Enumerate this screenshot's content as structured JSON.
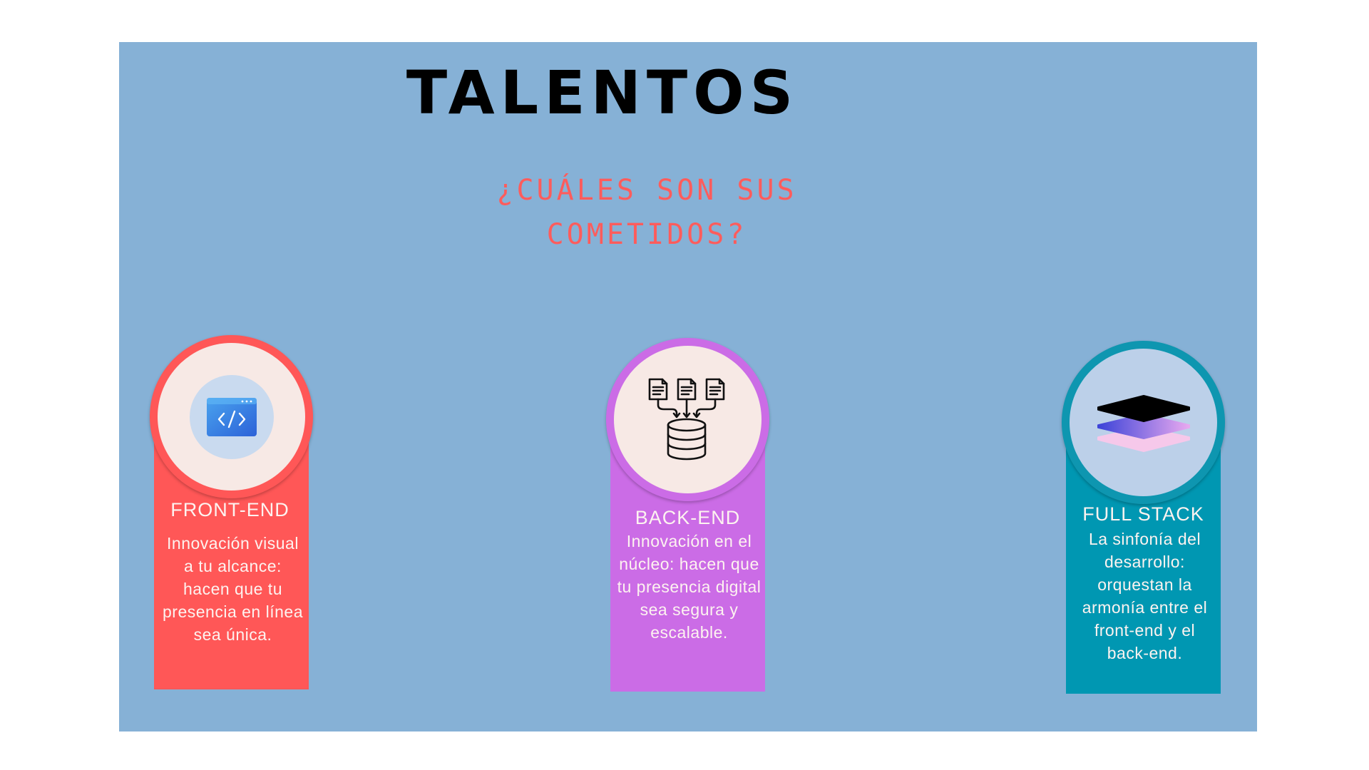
{
  "slide": {
    "title": "TALENTOS",
    "subtitle": "¿Cuáles son sus cometidos?",
    "background": "#86b1d6",
    "title_color": "#000000",
    "subtitle_color": "#ff5c5c"
  },
  "cards": [
    {
      "heading": "FRONT-END",
      "description": "Innovación visual a tu alcance: hacen que tu presencia en línea sea única.",
      "color": "#ff5757",
      "icon": "code-window-icon"
    },
    {
      "heading": "BACK-END",
      "description": "Innovación en el núcleo: hacen que tu presencia digital sea segura y escalable.",
      "color": "#cb6ce6",
      "icon": "database-documents-icon"
    },
    {
      "heading": "FULL STACK",
      "description": "La sinfonía del desarrollo: orquestan la armonía entre el front-end y el back-end.",
      "color": "#0097b2",
      "icon": "stack-layers-icon"
    }
  ]
}
